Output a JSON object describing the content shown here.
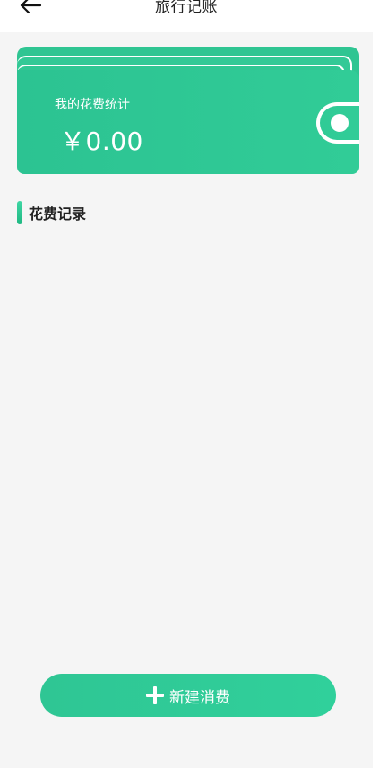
{
  "header": {
    "title": "旅行记账",
    "back_icon": "arrow-left-icon"
  },
  "wallet": {
    "label": "我的花费统计",
    "amount": "￥0.00",
    "icon": "wallet-icon"
  },
  "records": {
    "section_title": "花费记录",
    "items": []
  },
  "add_button": {
    "label": "新建消费",
    "icon": "plus-icon"
  },
  "colors": {
    "accent": "#2fc694",
    "accent_light": "#31cc97",
    "background": "#f5f5f5",
    "text": "#222222"
  }
}
